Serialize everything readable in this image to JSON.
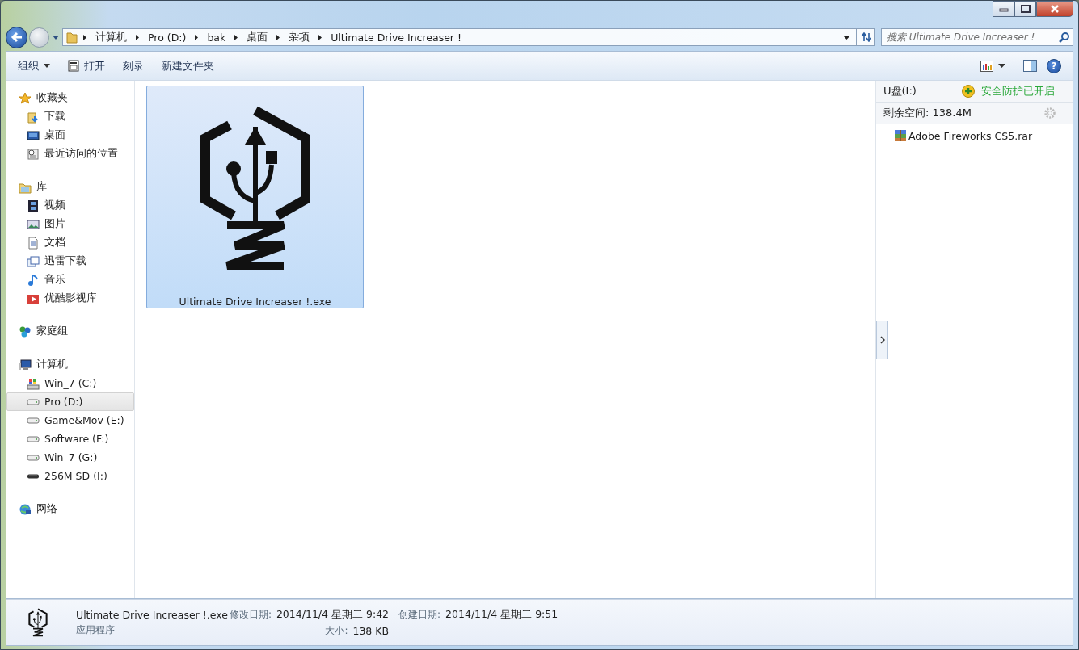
{
  "address_bar": {
    "segments": [
      "计算机",
      "Pro (D:)",
      "bak",
      "桌面",
      "杂项",
      "Ultimate Drive Increaser !"
    ]
  },
  "search": {
    "placeholder": "搜索 Ultimate Drive Increaser !"
  },
  "toolbar": [
    {
      "label": "组织",
      "kind": "menu"
    },
    {
      "label": "打开",
      "kind": "icon-button"
    },
    {
      "label": "刻录",
      "kind": "button"
    },
    {
      "label": "新建文件夹",
      "kind": "button"
    }
  ],
  "sidebar": {
    "groups": [
      {
        "label": "收藏夹",
        "selected": false,
        "children": [
          {
            "label": "下载",
            "selected": false
          },
          {
            "label": "桌面",
            "selected": false
          },
          {
            "label": "最近访问的位置",
            "selected": false
          }
        ]
      },
      {
        "label": "库",
        "selected": false,
        "children": [
          {
            "label": "视频",
            "selected": false
          },
          {
            "label": "图片",
            "selected": false
          },
          {
            "label": "文档",
            "selected": false
          },
          {
            "label": "迅雷下载",
            "selected": false
          },
          {
            "label": "音乐",
            "selected": false
          },
          {
            "label": "优酷影视库",
            "selected": false
          }
        ]
      },
      {
        "label": "家庭组",
        "selected": false
      },
      {
        "label": "计算机",
        "selected": false,
        "children": [
          {
            "label": "Win_7 (C:)",
            "selected": false
          },
          {
            "label": "Pro (D:)",
            "selected": true
          },
          {
            "label": "Game&Mov (E:)",
            "selected": false
          },
          {
            "label": "Software (F:)",
            "selected": false
          },
          {
            "label": "Win_7 (G:)",
            "selected": false
          },
          {
            "label": "256M SD (I:)",
            "selected": false
          }
        ]
      },
      {
        "label": "网络",
        "selected": false
      }
    ]
  },
  "help_button": {
    "label": "?"
  },
  "files": [
    {
      "name": "Ultimate Drive Increaser !.exe",
      "selected": true
    }
  ],
  "usb_panel": {
    "drive": "U盘(I:)",
    "protection": "安全防护已开启",
    "free_space": "剩余空间: 138.4M",
    "files": [
      "Adobe Fireworks CS5.rar"
    ]
  },
  "details": {
    "name": "Ultimate Drive Increaser !.exe",
    "type": "应用程序",
    "fields": [
      {
        "label": "修改日期:",
        "value": "2014/11/4 星期二 9:42"
      },
      {
        "label": "创建日期:",
        "value": "2014/11/4 星期二 9:51"
      },
      {
        "label": "大小:",
        "value": "138 KB"
      }
    ]
  }
}
